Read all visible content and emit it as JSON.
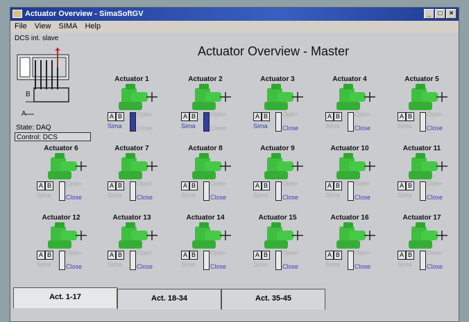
{
  "window": {
    "title": "Actuator Overview - SimaSoftGV"
  },
  "menu": [
    "File",
    "View",
    "SIMA",
    "Help"
  ],
  "content": {
    "dcs_label": "DCS int. slave",
    "title": "Actuator Overview - Master",
    "schematic_labels": {
      "b": "B",
      "a": "A"
    },
    "state": "State: DAQ",
    "control": "Control: DCS"
  },
  "colors": {
    "valve_green": "#3fbf3f",
    "position_active": "#32409a",
    "link_blue": "#3a3fc0"
  },
  "actuators": [
    {
      "name": "Actuator 1",
      "a": "A",
      "b": "B",
      "sima": "Sima",
      "open": "Open",
      "close": "Close",
      "active": true
    },
    {
      "name": "Actuator 2",
      "a": "A",
      "b": "B",
      "sima": "Sima",
      "open": "Open",
      "close": "Close",
      "active": true
    },
    {
      "name": "Actuator 3",
      "a": "A",
      "b": "B",
      "sima": "Sima",
      "open": "Open",
      "close": "Close",
      "active": false,
      "sima_on": true
    },
    {
      "name": "Actuator 4",
      "a": "A",
      "b": "B",
      "sima": "Sima",
      "open": "Open",
      "close": "Close",
      "active": false
    },
    {
      "name": "Actuator 5",
      "a": "A",
      "b": "B",
      "sima": "Sima",
      "open": "Open",
      "close": "Close",
      "active": false
    },
    {
      "name": "Actuator 6",
      "a": "A",
      "b": "B",
      "sima": "Sima",
      "open": "Open",
      "close": "Close",
      "active": false
    },
    {
      "name": "Actuator 7",
      "a": "A",
      "b": "B",
      "sima": "Sima",
      "open": "Open",
      "close": "Close",
      "active": false
    },
    {
      "name": "Actuator 8",
      "a": "A",
      "b": "B",
      "sima": "Sima",
      "open": "Open",
      "close": "Close",
      "active": false
    },
    {
      "name": "Actuator 9",
      "a": "A",
      "b": "B",
      "sima": "Sima",
      "open": "Open",
      "close": "Close",
      "active": false
    },
    {
      "name": "Actuator 10",
      "a": "A",
      "b": "B",
      "sima": "Sima",
      "open": "Open",
      "close": "Close",
      "active": false
    },
    {
      "name": "Actuator 11",
      "a": "A",
      "b": "B",
      "sima": "Sima",
      "open": "Open",
      "close": "Close",
      "active": false
    },
    {
      "name": "Actuator 12",
      "a": "A",
      "b": "B",
      "sima": "Sima",
      "open": "Open",
      "close": "Close",
      "active": false
    },
    {
      "name": "Actuator 13",
      "a": "A",
      "b": "B",
      "sima": "Sima",
      "open": "Open",
      "close": "Close",
      "active": false
    },
    {
      "name": "Actuator 14",
      "a": "A",
      "b": "B",
      "sima": "Sima",
      "open": "Open",
      "close": "Close",
      "active": false
    },
    {
      "name": "Actuator 15",
      "a": "A",
      "b": "B",
      "sima": "Sima",
      "open": "Open",
      "close": "Close",
      "active": false
    },
    {
      "name": "Actuator 16",
      "a": "A",
      "b": "B",
      "sima": "Sima",
      "open": "Open",
      "close": "Close",
      "active": false
    },
    {
      "name": "Actuator 17",
      "a": "A",
      "b": "B",
      "sima": "Sima",
      "open": "Open",
      "close": "Close",
      "active": false
    }
  ],
  "tabs": [
    "Act. 1-17",
    "Act. 18-34",
    "Act. 35-45"
  ]
}
